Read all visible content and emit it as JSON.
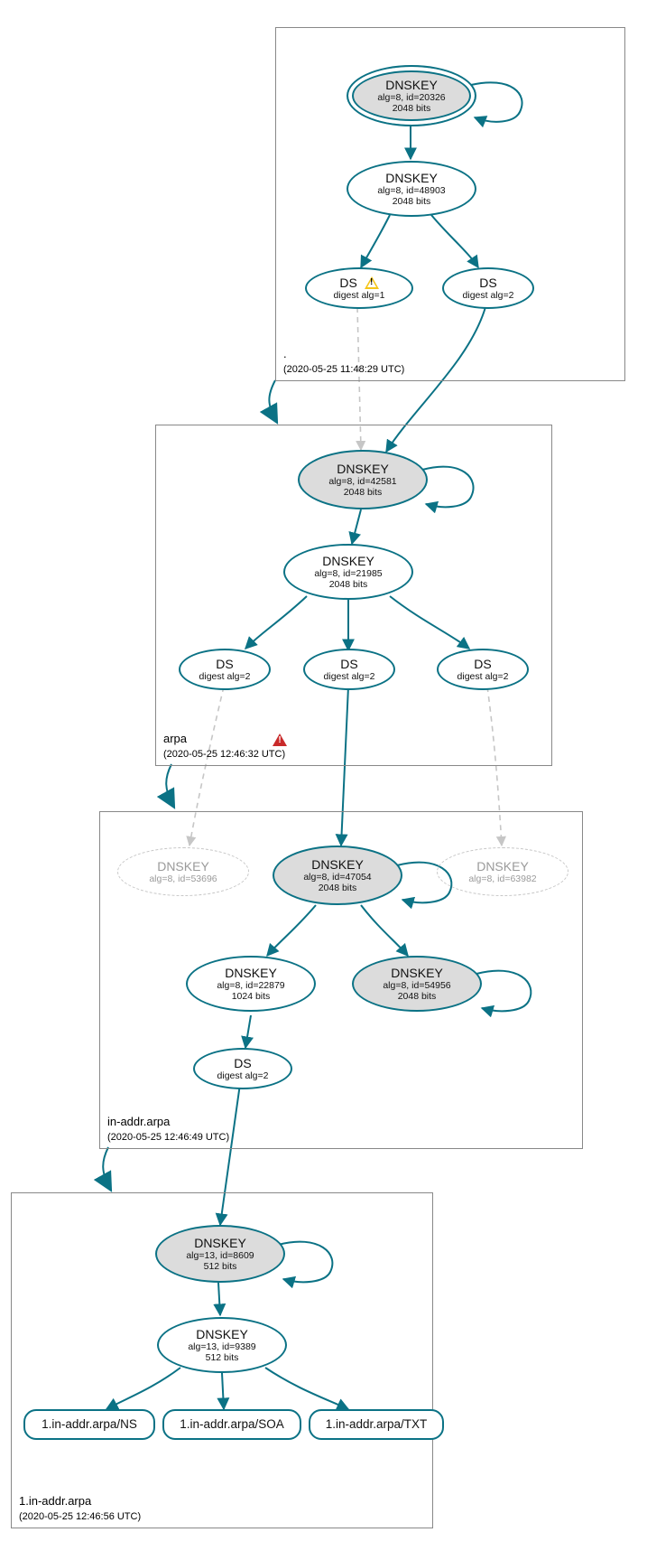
{
  "zones": {
    "root": {
      "label": ".",
      "timestamp": "(2020-05-25 11:48:29 UTC)"
    },
    "arpa": {
      "label": "arpa",
      "timestamp": "(2020-05-25 12:46:32 UTC)"
    },
    "inaddr": {
      "label": "in-addr.arpa",
      "timestamp": "(2020-05-25 12:46:49 UTC)"
    },
    "one": {
      "label": "1.in-addr.arpa",
      "timestamp": "(2020-05-25 12:46:56 UTC)"
    }
  },
  "nodes": {
    "root_ksk": {
      "title": "DNSKEY",
      "line2": "alg=8, id=20326",
      "line3": "2048 bits"
    },
    "root_zsk": {
      "title": "DNSKEY",
      "line2": "alg=8, id=48903",
      "line3": "2048 bits"
    },
    "root_ds1": {
      "title": "DS",
      "line2": "digest alg=1"
    },
    "root_ds2": {
      "title": "DS",
      "line2": "digest alg=2"
    },
    "arpa_ksk": {
      "title": "DNSKEY",
      "line2": "alg=8, id=42581",
      "line3": "2048 bits"
    },
    "arpa_zsk": {
      "title": "DNSKEY",
      "line2": "alg=8, id=21985",
      "line3": "2048 bits"
    },
    "arpa_ds_l": {
      "title": "DS",
      "line2": "digest alg=2"
    },
    "arpa_ds_c": {
      "title": "DS",
      "line2": "digest alg=2"
    },
    "arpa_ds_r": {
      "title": "DS",
      "line2": "digest alg=2"
    },
    "ia_ghost_l": {
      "title": "DNSKEY",
      "line2": "alg=8, id=53696"
    },
    "ia_ksk": {
      "title": "DNSKEY",
      "line2": "alg=8, id=47054",
      "line3": "2048 bits"
    },
    "ia_ghost_r": {
      "title": "DNSKEY",
      "line2": "alg=8, id=63982"
    },
    "ia_zsk": {
      "title": "DNSKEY",
      "line2": "alg=8, id=22879",
      "line3": "1024 bits"
    },
    "ia_ksk2": {
      "title": "DNSKEY",
      "line2": "alg=8, id=54956",
      "line3": "2048 bits"
    },
    "ia_ds": {
      "title": "DS",
      "line2": "digest alg=2"
    },
    "one_ksk": {
      "title": "DNSKEY",
      "line2": "alg=13, id=8609",
      "line3": "512 bits"
    },
    "one_zsk": {
      "title": "DNSKEY",
      "line2": "alg=13, id=9389",
      "line3": "512 bits"
    }
  },
  "rrsets": {
    "ns": "1.in-addr.arpa/NS",
    "soa": "1.in-addr.arpa/SOA",
    "txt": "1.in-addr.arpa/TXT"
  },
  "warn_label_ds": "DS"
}
